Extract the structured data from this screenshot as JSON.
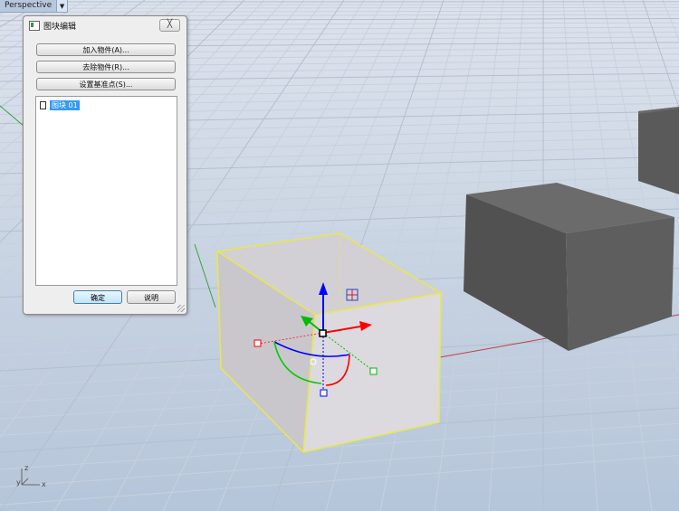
{
  "viewport": {
    "name": "Perspective",
    "dropdown_icon": "triangle-down",
    "axis_labels": {
      "z": "z",
      "y": "y",
      "x": "x"
    }
  },
  "dialog": {
    "title": "图块编辑",
    "close_label": "╳",
    "buttons": {
      "add": "加入物件(A)...",
      "remove": "去除物件(R)...",
      "set_base": "设置基准点(S)..."
    },
    "list_items": [
      {
        "label": "图块 01",
        "icon": "document-icon",
        "selected": true
      }
    ],
    "ok": "确定",
    "help": "说明"
  },
  "colors": {
    "sky": "#d6dde8",
    "selection_edge": "#e8e84a",
    "gumball_x": "#ff0000",
    "gumball_y": "#00cc00",
    "gumball_z": "#0000ff",
    "box_dark": "#555555"
  }
}
